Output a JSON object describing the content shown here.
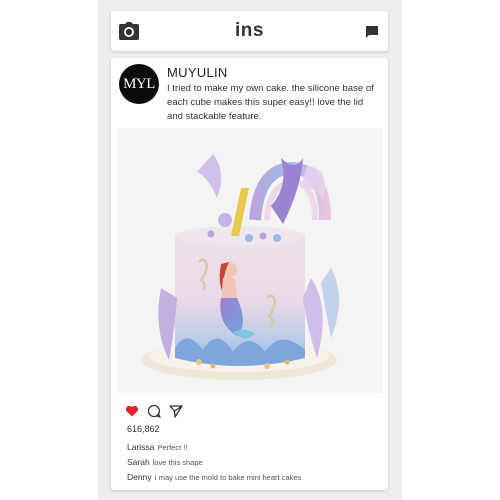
{
  "header": {
    "title": "ins",
    "camera_icon": "camera-icon",
    "message_icon": "chat-icon"
  },
  "post": {
    "avatar_text": "MYL",
    "username": "MUYULIN",
    "caption": "I tried to make my own cake. the silicone base of each cube makes this super easy!! love the lid and stackable feature.",
    "likes": "616,862",
    "actions": [
      "heart-icon",
      "comment-icon",
      "share-icon"
    ],
    "comments": [
      {
        "user": "Larissa",
        "text": "Perfect !!"
      },
      {
        "user": "Sarah",
        "text": "love this shape"
      },
      {
        "user": "Denny",
        "text": "I may use the mold to bake mini heart cakes"
      }
    ]
  },
  "colors": {
    "like_red": "#e0242b",
    "page_bg": "#eeeeee",
    "card_bg": "#ffffff"
  }
}
